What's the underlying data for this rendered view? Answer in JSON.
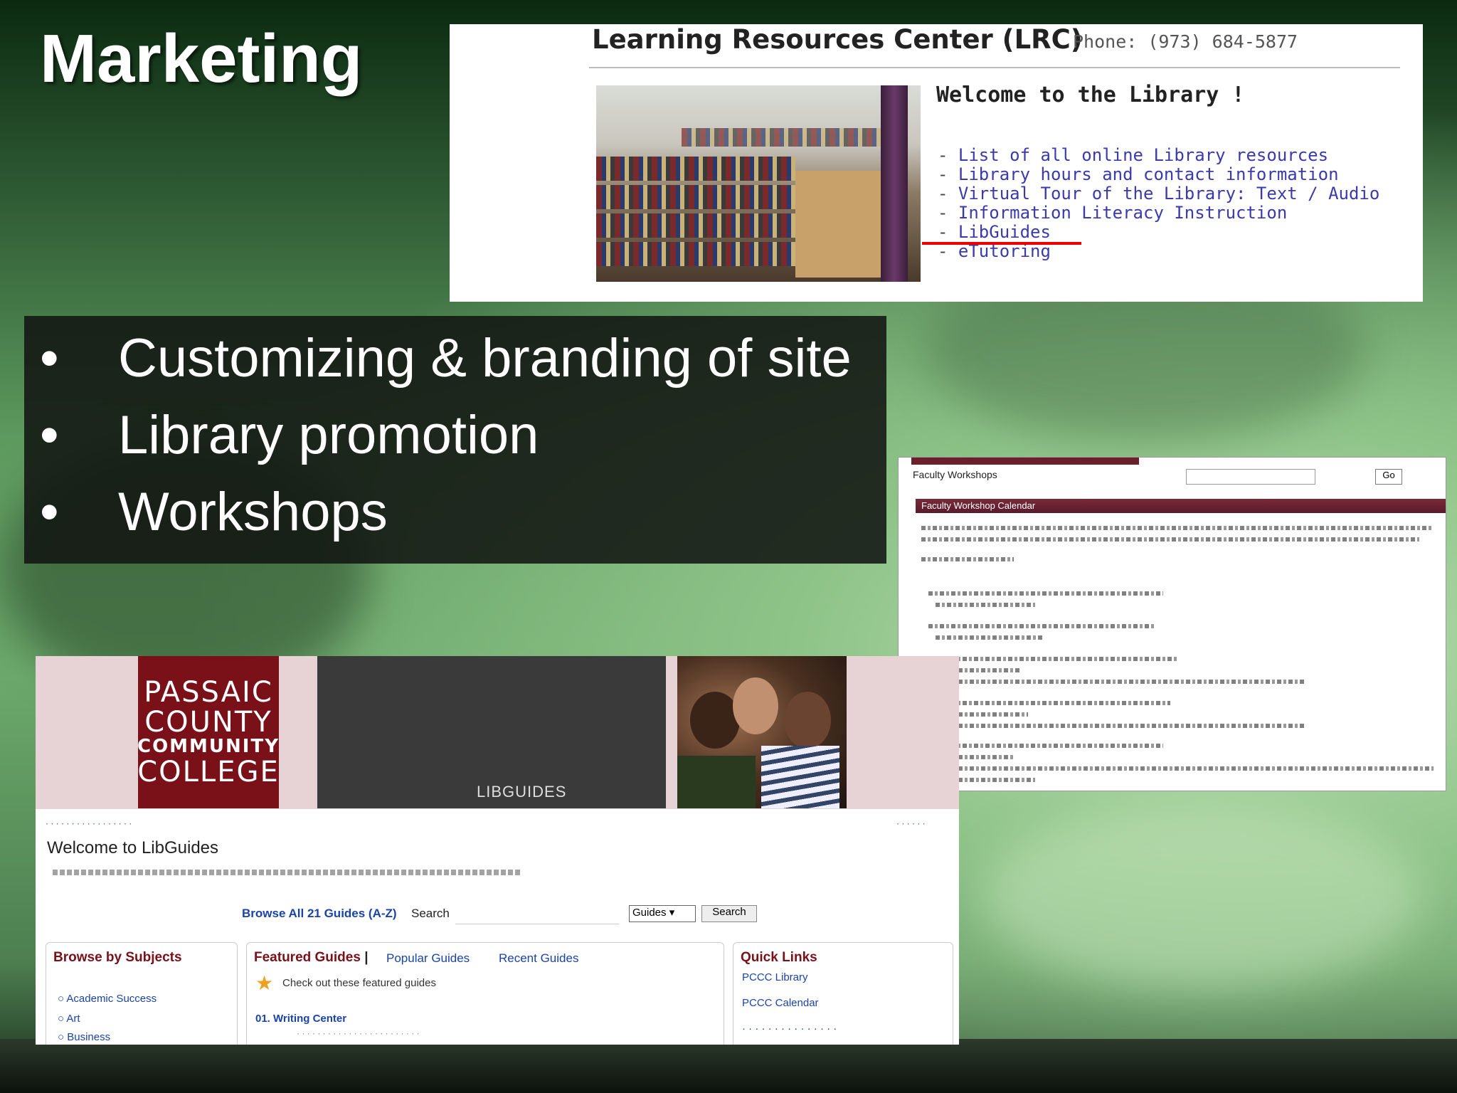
{
  "slide": {
    "title": "Marketing",
    "bullets": [
      "Customizing & branding of site",
      "Library promotion",
      "Workshops"
    ]
  },
  "lrc_screenshot": {
    "title": "Learning Resources Center (LRC)",
    "phone": "Phone: (973) 684-5877",
    "welcome": "Welcome to the Library !",
    "links": [
      "List of all online Library resources",
      "Library hours and contact information",
      "Virtual Tour of the Library: Text / Audio",
      "Information Literacy Instruction",
      "LibGuides",
      "eTutoring"
    ]
  },
  "workshops_screenshot": {
    "tab_label": "Faculty Workshops",
    "header": "Faculty Workshop Calendar",
    "go_label": "Go"
  },
  "libguides_screenshot": {
    "college_name": [
      "PASSAIC",
      "COUNTY",
      "COMMUNITY",
      "COLLEGE"
    ],
    "banner_label": "LIBGUIDES",
    "welcome": "Welcome to LibGuides",
    "browse_link": "Browse All 21 Guides (A-Z)",
    "search_label": "Search",
    "search_select": "Guides",
    "search_button": "Search",
    "panels": {
      "browse": {
        "title": "Browse by Subjects",
        "items": [
          "Academic Success",
          "Art",
          "Business"
        ]
      },
      "featured": {
        "title": "Featured Guides",
        "tab_popular": "Popular Guides",
        "tab_recent": "Recent Guides",
        "prompt": "Check out these featured guides",
        "item": "01. Writing Center"
      },
      "quick_links": {
        "title": "Quick Links",
        "items": [
          "PCCC Library",
          "PCCC Calendar"
        ]
      }
    }
  },
  "colors": {
    "maroon": "#7a1018",
    "link_blue": "#1a44a8",
    "lrc_link": "#3a3ab0",
    "highlight_red": "#e00000"
  }
}
